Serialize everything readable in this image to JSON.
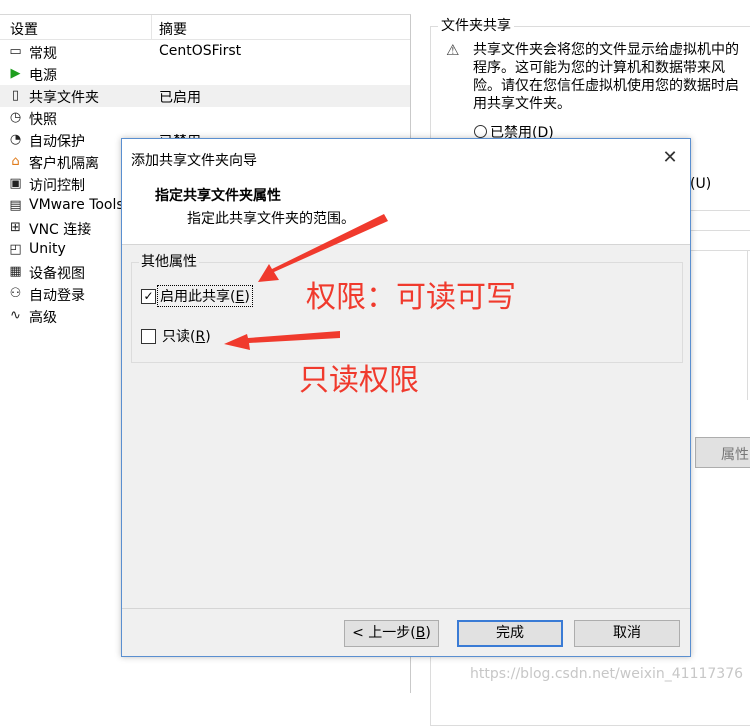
{
  "settings": {
    "col_setting": "设置",
    "col_summary": "摘要",
    "items": [
      {
        "icon": "monitor-icon",
        "glyph": "▭",
        "name": "常规",
        "summary": "CentOSFirst"
      },
      {
        "icon": "power-play-icon",
        "glyph": "▶",
        "name": "电源",
        "summary": ""
      },
      {
        "icon": "shared-folder-icon",
        "glyph": "▯",
        "name": "共享文件夹",
        "summary": "已启用"
      },
      {
        "icon": "snapshot-icon",
        "glyph": "◷",
        "name": "快照",
        "summary": ""
      },
      {
        "icon": "autoprotect-icon",
        "glyph": "◔",
        "name": "自动保护",
        "summary": "已禁用"
      },
      {
        "icon": "lock-icon",
        "glyph": "⌂",
        "name": "客户机隔离",
        "summary": ""
      },
      {
        "icon": "access-control-icon",
        "glyph": "▣",
        "name": "访问控制",
        "summary": ""
      },
      {
        "icon": "vmware-tools-icon",
        "glyph": "▤",
        "name": "VMware Tools",
        "summary": ""
      },
      {
        "icon": "vnc-icon",
        "glyph": "⊞",
        "name": "VNC 连接",
        "summary": ""
      },
      {
        "icon": "unity-icon",
        "glyph": "◰",
        "name": "Unity",
        "summary": ""
      },
      {
        "icon": "device-view-icon",
        "glyph": "▦",
        "name": "设备视图",
        "summary": ""
      },
      {
        "icon": "autologin-icon",
        "glyph": "⚇",
        "name": "自动登录",
        "summary": ""
      },
      {
        "icon": "advanced-icon",
        "glyph": "∿",
        "name": "高级",
        "summary": ""
      }
    ]
  },
  "shared": {
    "title": "文件夹共享",
    "warning": "共享文件夹会将您的文件显示给虚拟机中的程序。这可能为您的计算机和数据带来风险。请仅在您信任虚拟机使用您的数据时启用共享文件夹。",
    "radio_disabled": "已禁用(D)",
    "radio_partial": "(U)",
    "properties_button": "属性"
  },
  "dialog": {
    "title": "添加共享文件夹向导",
    "heading": "指定共享文件夹属性",
    "subheading": "指定此共享文件夹的范围。",
    "group_label": "其他属性",
    "enable_share": {
      "text": "启用此共享(",
      "key": "E",
      "end": ")",
      "checked": "✓"
    },
    "read_only": {
      "text": "只读(",
      "key": "R",
      "end": ")"
    },
    "back": {
      "text": "< 上一步(",
      "key": "B",
      "end": ")"
    },
    "finish": "完成",
    "cancel": "取消"
  },
  "annotations": {
    "read_write": "权限：可读可写",
    "read_only": "只读权限"
  },
  "watermark": "https://blog.csdn.net/weixin_41117376"
}
